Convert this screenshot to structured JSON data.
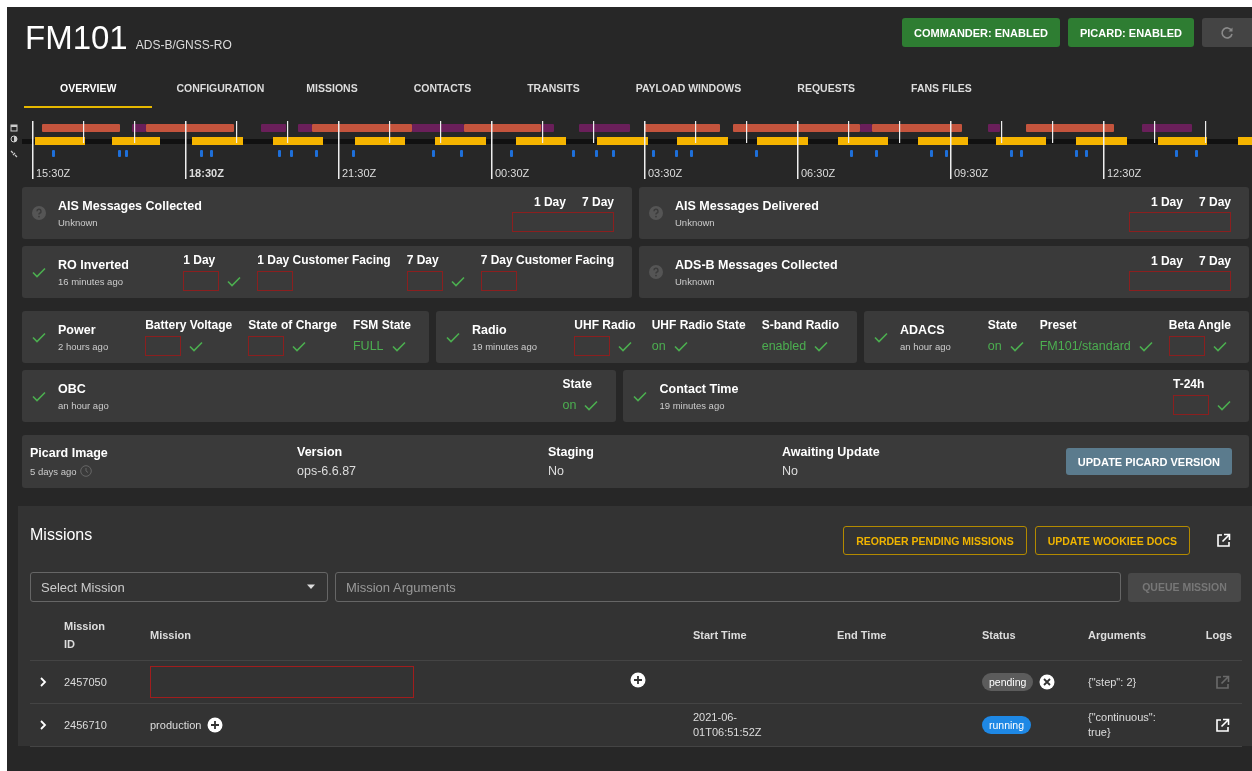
{
  "header": {
    "title": "FM101",
    "subtitle": "ADS-B/GNSS-RO",
    "buttons": [
      {
        "label": "COMMANDER: ENABLED"
      },
      {
        "label": "PICARD: ENABLED"
      }
    ]
  },
  "tabs": [
    {
      "label": "OVERVIEW",
      "selected": true
    },
    {
      "label": "CONFIGURATION",
      "selected": false
    },
    {
      "label": "MISSIONS",
      "selected": false
    },
    {
      "label": "CONTACTS",
      "selected": false
    },
    {
      "label": "TRANSITS",
      "selected": false
    },
    {
      "label": "PAYLOAD WINDOWS",
      "selected": false
    },
    {
      "label": "REQUESTS",
      "selected": false
    },
    {
      "label": "FANS FILES",
      "selected": false
    }
  ],
  "timeline": {
    "ticks": [
      {
        "label": "15:30Z",
        "current": false
      },
      {
        "label": "18:30Z",
        "current": true
      },
      {
        "label": "21:30Z",
        "current": false
      },
      {
        "label": "00:30Z",
        "current": false
      },
      {
        "label": "03:30Z",
        "current": false
      },
      {
        "label": "06:30Z",
        "current": false
      },
      {
        "label": "09:30Z",
        "current": false
      },
      {
        "label": "12:30Z",
        "current": false
      }
    ]
  },
  "card_groups": [
    {
      "cards": [
        {
          "title": "AIS Messages Collected",
          "subtitle": "Unknown",
          "verified": false,
          "shared_box": true,
          "fields": [
            {
              "label": "1 Day"
            },
            {
              "label": "7 Day"
            }
          ]
        },
        {
          "title": "AIS Messages Delivered",
          "subtitle": "Unknown",
          "verified": false,
          "shared_box": true,
          "fields": [
            {
              "label": "1 Day"
            },
            {
              "label": "7 Day"
            }
          ]
        }
      ]
    },
    {
      "cards": [
        {
          "title": "RO Inverted",
          "subtitle": "16 minutes ago",
          "verified": true,
          "shared_box": false,
          "fields": [
            {
              "label": "1 Day",
              "checked": true
            },
            {
              "label": "1 Day Customer Facing",
              "checked": false
            },
            {
              "label": "7 Day",
              "checked": true
            },
            {
              "label": "7 Day Customer Facing",
              "checked": false
            }
          ]
        },
        {
          "title": "ADS-B Messages Collected",
          "subtitle": "Unknown",
          "verified": false,
          "shared_box": true,
          "fields": [
            {
              "label": "1 Day"
            },
            {
              "label": "7 Day"
            }
          ]
        }
      ]
    },
    {
      "cards": [
        {
          "title": "Power",
          "subtitle": "2 hours ago",
          "verified": true,
          "shared_box": false,
          "fields": [
            {
              "label": "Battery Voltage",
              "checked": true
            },
            {
              "label": "State of Charge",
              "checked": true
            },
            {
              "label": "FSM State",
              "value": "FULL",
              "checked": true
            }
          ]
        },
        {
          "title": "Radio",
          "subtitle": "19 minutes ago",
          "verified": true,
          "shared_box": false,
          "fields": [
            {
              "label": "UHF Radio",
              "checked": true
            },
            {
              "label": "UHF Radio State",
              "value": "on",
              "checked": true
            },
            {
              "label": "S-band Radio",
              "value": "enabled",
              "checked": true
            }
          ]
        },
        {
          "title": "ADACS",
          "subtitle": "an hour ago",
          "verified": true,
          "shared_box": false,
          "fields": [
            {
              "label": "State",
              "value": "on",
              "checked": true
            },
            {
              "label": "Preset",
              "value": "FM101/standard",
              "checked": true
            },
            {
              "label": "Beta Angle",
              "checked": true
            }
          ]
        }
      ]
    },
    {
      "cards": [
        {
          "title": "OBC",
          "subtitle": "an hour ago",
          "verified": true,
          "shared_box": false,
          "fields": [
            {
              "label": "State",
              "value": "on",
              "checked": true
            }
          ]
        },
        {
          "title": "Contact Time",
          "subtitle": "19 minutes ago",
          "verified": true,
          "shared_box": false,
          "fields": [
            {
              "label": "T-24h",
              "checked": true
            }
          ]
        }
      ]
    }
  ],
  "picard": {
    "title": "Picard Image",
    "subtitle": "5 days ago",
    "fields": [
      {
        "label": "Version",
        "value": "ops-6.6.87"
      },
      {
        "label": "Staging",
        "value": "No"
      },
      {
        "label": "Awaiting Update",
        "value": "No"
      }
    ],
    "button": "UPDATE PICARD VERSION"
  },
  "missions": {
    "title": "Missions",
    "buttons": [
      {
        "label": "REORDER PENDING MISSIONS"
      },
      {
        "label": "UPDATE WOOKIEE DOCS"
      }
    ],
    "select": {
      "placeholder": "Select Mission"
    },
    "arguments": {
      "placeholder": "Mission Arguments"
    },
    "queue_button": {
      "label": "QUEUE MISSION",
      "disabled": true
    },
    "columns": [
      "Mission ID",
      "Mission",
      "Start Time",
      "End Time",
      "Status",
      "Arguments",
      "Logs"
    ],
    "rows": [
      {
        "id": "2457050",
        "status": "pending",
        "color": "#5c5c5c",
        "cancellable": true,
        "arguments": "{\"step\": 2}",
        "logs_enabled": false
      },
      {
        "id": "2456710",
        "mission": "production",
        "start_time": "2021-06-01T06:51:52Z",
        "status": "running",
        "color": "#1e88e5",
        "cancellable": false,
        "arguments": "{\"continuous\": true}",
        "logs_enabled": true
      }
    ]
  }
}
